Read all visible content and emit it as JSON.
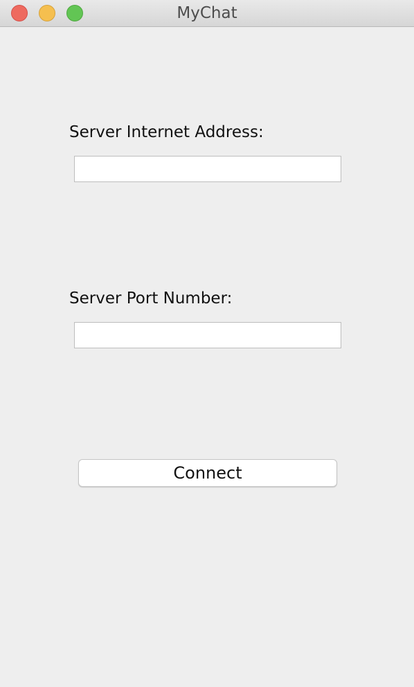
{
  "window": {
    "title": "MyChat",
    "controls": [
      "close-icon",
      "minimize-icon",
      "zoom-icon"
    ]
  },
  "form": {
    "address": {
      "label": "Server Internet Address:",
      "value": "",
      "placeholder": ""
    },
    "port": {
      "label": "Server Port Number:",
      "value": "",
      "placeholder": ""
    },
    "connect_label": "Connect"
  },
  "colors": {
    "close": "#ee6a5f",
    "minimize": "#f5bf4f",
    "zoom": "#62c554",
    "background": "#eeeeee"
  }
}
